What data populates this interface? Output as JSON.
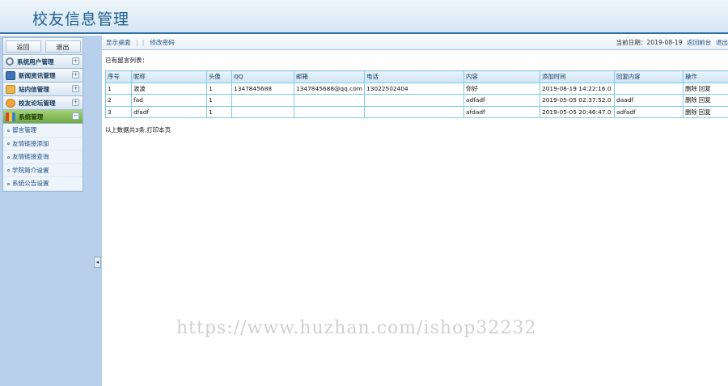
{
  "header": {
    "title": "校友信息管理"
  },
  "sidebar": {
    "top_buttons": {
      "back": "返回",
      "exit": "退出"
    },
    "groups": [
      {
        "label": "系统用户管理",
        "toggle": "+"
      },
      {
        "label": "新闻资讯管理",
        "toggle": "+"
      },
      {
        "label": "站内信管理",
        "toggle": "+"
      },
      {
        "label": "校友论坛管理",
        "toggle": "+"
      },
      {
        "label": "系统管理",
        "toggle": "−"
      }
    ],
    "sub_items": [
      "留言管理",
      "友情链接添加",
      "友情链接查询",
      "学院简介设置",
      "系统公告设置"
    ],
    "collapse": "◂"
  },
  "topbar": {
    "home": "显示桌面",
    "change_password": "修改密码",
    "date_text": "当前日期：2019-08-19",
    "back_front": "返回前台",
    "logout": "退出"
  },
  "main": {
    "list_title": "已有留言列表：",
    "columns": [
      "序号",
      "昵称",
      "头像",
      "QQ",
      "邮箱",
      "电话",
      "内容",
      "添加时间",
      "回复内容",
      "操作"
    ],
    "rows": [
      {
        "no": "1",
        "nick": "波波",
        "avatar": "1",
        "qq": "1347845688",
        "email": "1347845688@qq.com",
        "phone": "13022502404",
        "content": "你好",
        "time": "2019-08-19 14:22:16.0",
        "reply": "",
        "op_delete": "删除",
        "op_reply": "回复"
      },
      {
        "no": "2",
        "nick": "fad",
        "avatar": "1",
        "qq": "",
        "email": "",
        "phone": "",
        "content": "adfadf",
        "time": "2019-05-05 02:37:52.0",
        "reply": "daadf",
        "op_delete": "删除",
        "op_reply": "回复"
      },
      {
        "no": "3",
        "nick": "dfadf",
        "avatar": "1",
        "qq": "",
        "email": "",
        "phone": "",
        "content": "afdadf",
        "time": "2019-05-05 20:46:47.0",
        "reply": "adfadf",
        "op_delete": "删除",
        "op_reply": "回复"
      }
    ],
    "summary": "以上数据共3条,打印本页"
  },
  "watermark": "https://www.huzhan.com/ishop32232"
}
